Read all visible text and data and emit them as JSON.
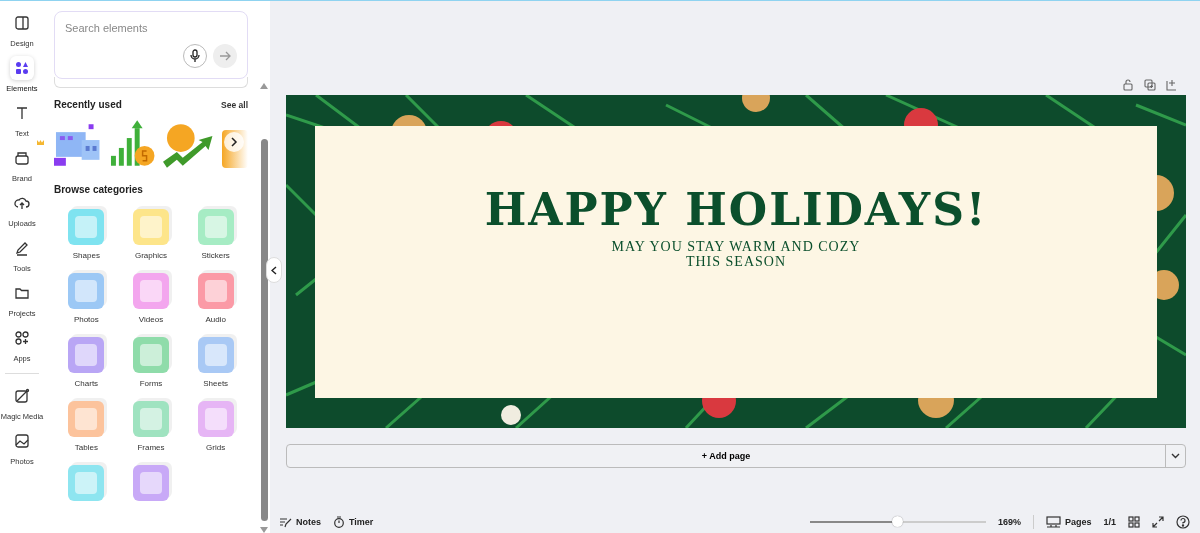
{
  "rail": [
    {
      "label": "Design",
      "selected": false
    },
    {
      "label": "Elements",
      "selected": true
    },
    {
      "label": "Text",
      "selected": false
    },
    {
      "label": "Brand",
      "selected": false
    },
    {
      "label": "Uploads",
      "selected": false
    },
    {
      "label": "Tools",
      "selected": false
    },
    {
      "label": "Projects",
      "selected": false
    },
    {
      "label": "Apps",
      "selected": false
    },
    {
      "label": "Magic Media",
      "selected": false
    },
    {
      "label": "Photos",
      "selected": false
    }
  ],
  "search": {
    "placeholder": "Search elements"
  },
  "recent": {
    "title": "Recently used",
    "link": "See all"
  },
  "browse": {
    "title": "Browse categories",
    "items": [
      {
        "label": "Shapes",
        "color": "#7fe3f0"
      },
      {
        "label": "Graphics",
        "color": "#fde58a"
      },
      {
        "label": "Stickers",
        "color": "#a6ecc4"
      },
      {
        "label": "Photos",
        "color": "#9cc8f5"
      },
      {
        "label": "Videos",
        "color": "#f3a6ee"
      },
      {
        "label": "Audio",
        "color": "#fb9aa6"
      },
      {
        "label": "Charts",
        "color": "#b9a6f5"
      },
      {
        "label": "Forms",
        "color": "#8fdcaa"
      },
      {
        "label": "Sheets",
        "color": "#a9c9f5"
      },
      {
        "label": "Tables",
        "color": "#fcc39c"
      },
      {
        "label": "Frames",
        "color": "#9fe3c0"
      },
      {
        "label": "Grids",
        "color": "#e6b5f5"
      },
      {
        "color": "#8ee5f0"
      },
      {
        "color": "#c8a9f7"
      }
    ]
  },
  "design": {
    "title": "HAPPY HOLIDAYS!",
    "subtitle_lines": [
      "MAY YOU STAY WARM AND COZY",
      "THIS SEASON"
    ]
  },
  "add_page": "+ Add page",
  "footer": {
    "notes": "Notes",
    "timer": "Timer",
    "zoom": {
      "level": 0.5,
      "reading": "169%"
    },
    "pages": "Pages",
    "page_count": "1/1"
  }
}
